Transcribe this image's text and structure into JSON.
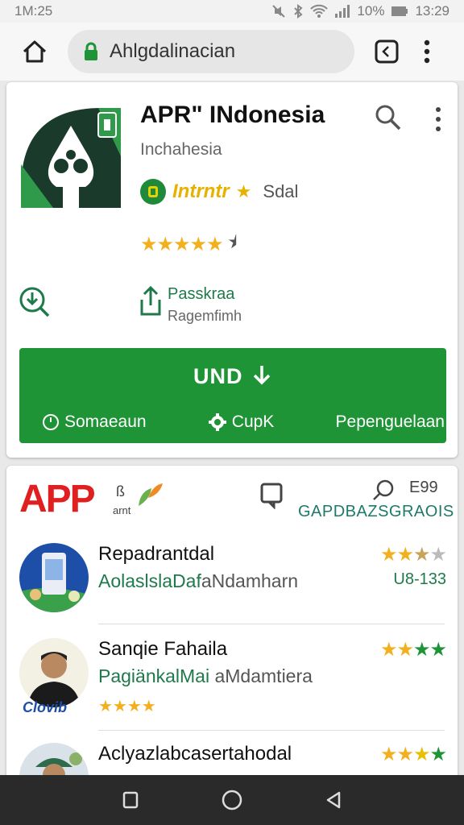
{
  "status": {
    "time": "1M:25",
    "battery": "10%",
    "clock": "13:29"
  },
  "browser": {
    "url": "Ahlgdalinacian"
  },
  "app": {
    "title": "APR\" INdonesia",
    "subtitle": "Inchahesia",
    "badge_text": "Intrntr",
    "badge_label": "Sdal",
    "rating_stars": "★★★★★",
    "share_title": "Passkraa",
    "share_sub": "Ragemfimh",
    "install_label": "UND",
    "options": [
      "Somaeaun",
      "CupK",
      "Pepenguelaan"
    ]
  },
  "section": {
    "logo_text": "APP",
    "logo_small": "ß",
    "logo_small2": "arnt",
    "count": "E99",
    "title": "GAPDBAZSGRAOIS",
    "items": [
      {
        "name": "Repadrantdal",
        "sub_green": "AolaslslaDaf",
        "sub_plain": "aNdamharn",
        "stars": "★★★★★",
        "meta": "U8-133"
      },
      {
        "name": "Sanqie Fahaila",
        "sub_green": "PagiänkalMai",
        "sub_plain": " aMdamtiera",
        "stars": "★★★★★",
        "mini": "★★★★",
        "avatar_tag": "Clovib"
      },
      {
        "name": "Aclyazlabcasertahodal",
        "sub_green": "",
        "sub_plain": "",
        "stars": "★★★★★"
      }
    ]
  },
  "colors": {
    "primary_green": "#1f9436",
    "star_yellow": "#f2b01e",
    "logo_red": "#e02020"
  }
}
